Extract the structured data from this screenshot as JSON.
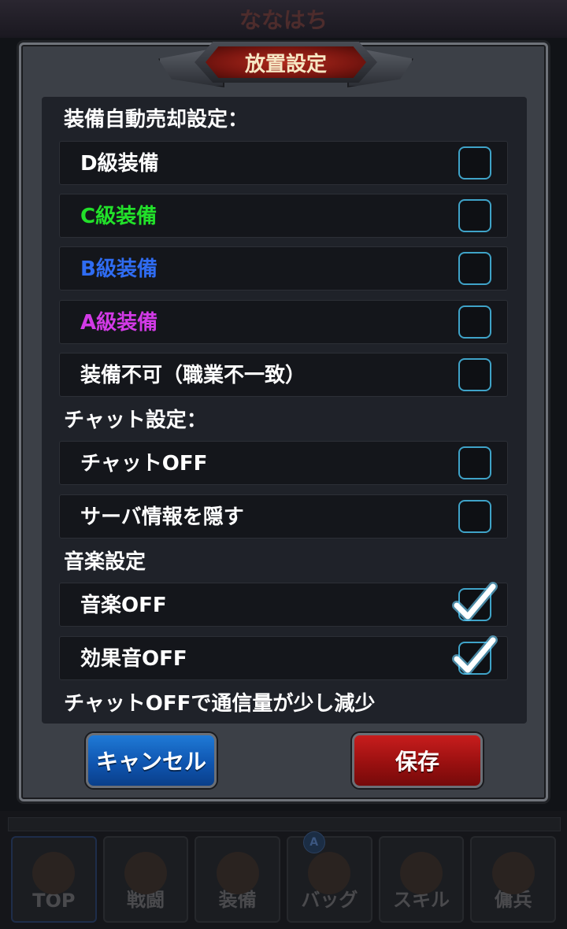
{
  "background": {
    "title": "ななはち",
    "nav": [
      {
        "label": "TOP",
        "icon": "top-icon"
      },
      {
        "label": "戦闘",
        "icon": "battle-icon"
      },
      {
        "label": "装備",
        "icon": "equipment-icon"
      },
      {
        "label": "バッグ",
        "icon": "bag-icon"
      },
      {
        "label": "スキル",
        "icon": "skill-icon"
      },
      {
        "label": "傭兵",
        "icon": "mercenary-icon"
      }
    ],
    "badge": "A"
  },
  "dialog": {
    "title": "放置設定",
    "equipment_section": "装備自動売却設定：",
    "equipment_rows": [
      {
        "label": "D級装備",
        "color": "#ffffff",
        "checked": false
      },
      {
        "label": "C級装備",
        "color": "#22e02a",
        "checked": false
      },
      {
        "label": "B級装備",
        "color": "#2f6cf2",
        "checked": false
      },
      {
        "label": "A級装備",
        "color": "#d23ae6",
        "checked": false
      },
      {
        "label": "装備不可（職業不一致）",
        "color": "#ffffff",
        "checked": false
      }
    ],
    "chat_section": "チャット設定：",
    "chat_rows": [
      {
        "label": "チャットOFF",
        "checked": false
      },
      {
        "label": "サーバ情報を隠す",
        "checked": false
      }
    ],
    "music_section": "音楽設定",
    "music_rows": [
      {
        "label": "音楽OFF",
        "checked": true
      },
      {
        "label": "効果音OFF",
        "checked": true
      }
    ],
    "note": "チャットOFFで通信量が少し減少",
    "cancel_label": "キャンセル",
    "save_label": "保存"
  },
  "colors": {
    "checkbox_border": "#3fa3c8",
    "check_mark": "#ffffff",
    "cancel_button": "#0f55b0",
    "save_button": "#9a1010",
    "title_plate": "#8a1a12"
  }
}
